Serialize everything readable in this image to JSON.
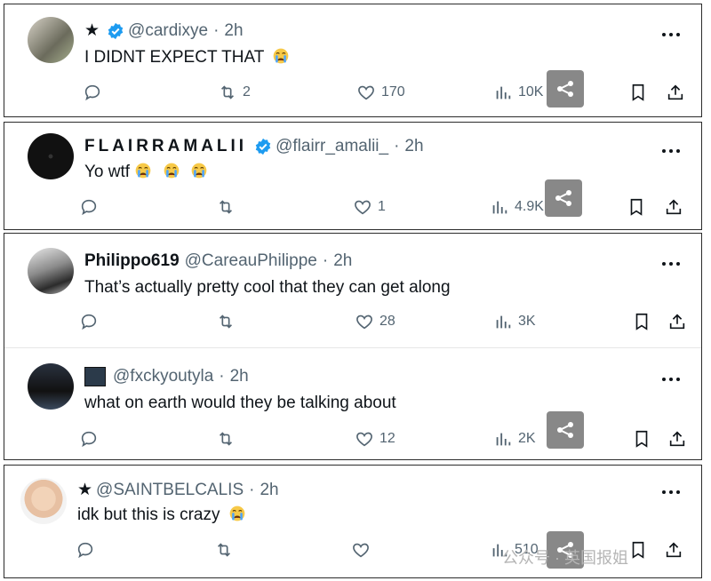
{
  "tweets": [
    {
      "star": "★",
      "name": "",
      "handle": "@cardixye",
      "dot": "·",
      "time": "2h",
      "text": "I DIDNT EXPECT THAT",
      "replies": "",
      "retweets": "2",
      "likes": "170",
      "views": "10K",
      "verified": true
    },
    {
      "star": "",
      "name": "FLAIRRAMALII",
      "handle": "@flairr_amalii_",
      "dot": "·",
      "time": "2h",
      "text": "Yo wtf",
      "replies": "",
      "retweets": "",
      "likes": "1",
      "views": "4.9K",
      "verified": true
    },
    {
      "star": "",
      "name": "Philippo619",
      "handle": "@CareauPhilippe",
      "dot": "·",
      "time": "2h",
      "text": "That’s actually pretty cool that they can get along",
      "replies": "",
      "retweets": "",
      "likes": "28",
      "views": "3K",
      "verified": false
    },
    {
      "star": "",
      "name": "",
      "handle": "@fxckyoutyla",
      "dot": "·",
      "time": "2h",
      "text": "what on earth would they be talking about",
      "replies": "",
      "retweets": "",
      "likes": "12",
      "views": "2K",
      "verified": false
    },
    {
      "star": "★",
      "name": "",
      "handle": "@SAINTBELCALIS",
      "dot": "·",
      "time": "2h",
      "text": "idk but this is crazy",
      "replies": "",
      "retweets": "",
      "likes": "",
      "views": "510",
      "verified": false
    }
  ],
  "watermark": {
    "text": "公众号 · 英国报姐"
  },
  "icons": {
    "reply": "reply-icon",
    "retweet": "retweet-icon",
    "like": "heart-icon",
    "views": "views-chart-icon",
    "bookmark": "bookmark-icon",
    "share": "share-icon",
    "more": "more-dots-icon",
    "verified": "verified-badge-icon",
    "emoji": "loudly-crying-face-emoji"
  },
  "colors": {
    "text": "#0f1419",
    "muted": "#536471",
    "verified": "#1d9bf0",
    "border": "#2b2b2b",
    "share_badge": "#888888"
  }
}
